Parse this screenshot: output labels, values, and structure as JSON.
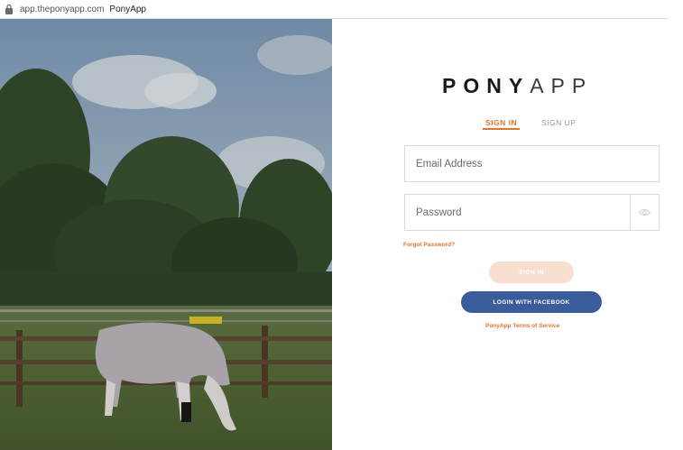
{
  "browser": {
    "url": "app.theponyapp.com",
    "page_title": "PonyApp"
  },
  "logo": {
    "bold_part": "PONY",
    "light_part": "APP"
  },
  "tabs": {
    "signin": "SIGN IN",
    "signup": "SIGN UP",
    "active": "signin"
  },
  "form": {
    "email_placeholder": "Email Address",
    "email_value": "",
    "password_placeholder": "Password",
    "password_value": "",
    "forgot_label": "Forgot Password?",
    "signin_label": "SIGN IN",
    "facebook_label": "LOGIN WITH FACEBOOK",
    "terms_label": "PonyApp Terms of Service"
  },
  "colors": {
    "accent": "#e0742e",
    "signin_button_disabled": "#f9dfcf",
    "facebook_blue": "#3b5c9b"
  },
  "icons": {
    "lock": "lock-icon",
    "eye": "eye-icon"
  }
}
